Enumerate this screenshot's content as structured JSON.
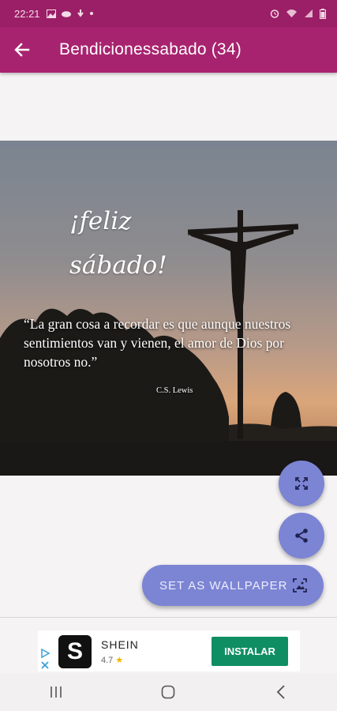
{
  "status_bar": {
    "time": "22:21",
    "left_icons": [
      "image-icon",
      "cloud-icon",
      "gesture-icon",
      "dot-icon"
    ],
    "right_icons": [
      "alarm-icon",
      "wifi-icon",
      "signal-icon",
      "battery-icon"
    ]
  },
  "app_bar": {
    "title": "Bendicionessabado (34)",
    "back_icon": "arrow-left-icon",
    "color": "#a8236f"
  },
  "image": {
    "greeting_line1": "¡feliz",
    "greeting_line2": "sábado!",
    "quote": "“La gran cosa a recordar es que aunque nuestros sentimientos van y vienen, el amor de Dios por nosotros no.”",
    "author": "C.S. Lewis"
  },
  "actions": {
    "fullscreen_icon": "fullscreen-icon",
    "share_icon": "share-icon",
    "set_wallpaper_label": "SET AS WALLPAPER",
    "wallpaper_icon": "wallpaper-icon",
    "accent_color": "#7c84d4"
  },
  "ad": {
    "brand": "SHEIN",
    "logo_letter": "S",
    "rating": "4.7",
    "install_label": "INSTALAR",
    "install_color": "#0f8e63"
  },
  "nav_bar": {
    "keys": [
      "recents-icon",
      "home-icon",
      "back-icon"
    ]
  }
}
